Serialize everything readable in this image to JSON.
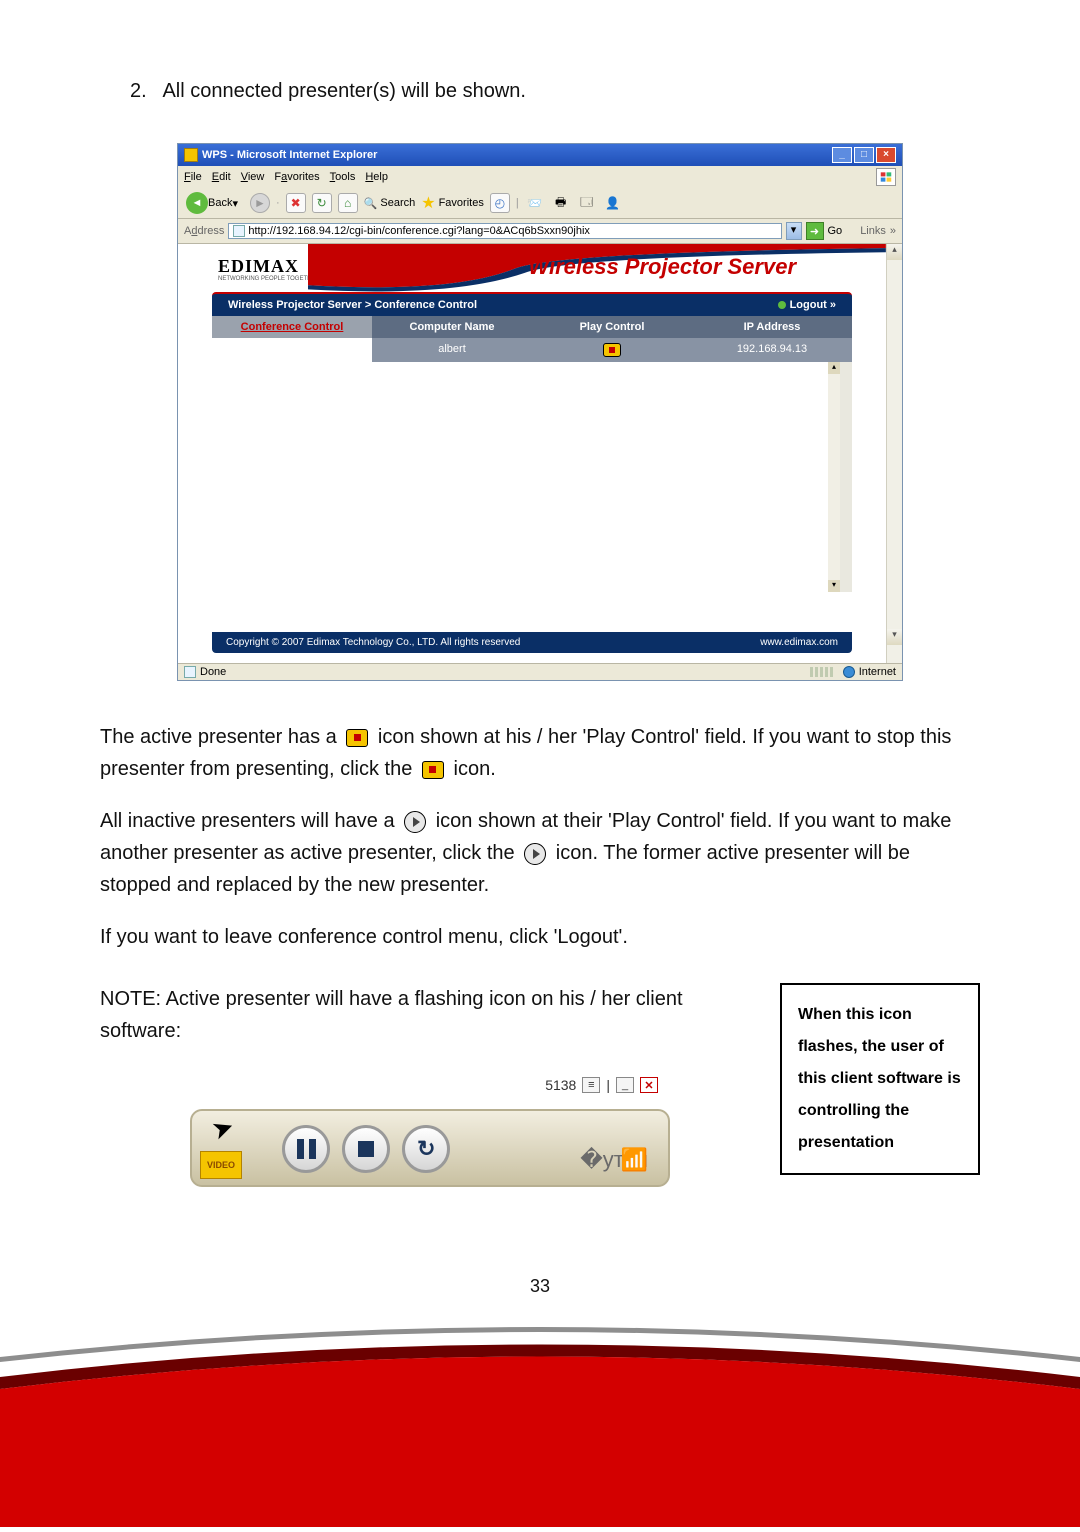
{
  "intro": {
    "num": "2.",
    "text": "All connected presenter(s) will be shown."
  },
  "ie": {
    "title": "WPS - Microsoft Internet Explorer",
    "menus": {
      "file": "File",
      "edit": "Edit",
      "view": "View",
      "favorites": "Favorites",
      "tools": "Tools",
      "help": "Help"
    },
    "toolbar": {
      "back": "Back",
      "search": "Search",
      "favorites": "Favorites"
    },
    "address_label": "Address",
    "url": "http://192.168.94.12/cgi-bin/conference.cgi?lang=0&ACq6bSxxn90jhix",
    "go": "Go",
    "links": "Links",
    "status_done": "Done",
    "status_zone": "Internet"
  },
  "wps": {
    "logo": "EDIMAX",
    "logo_sub": "NETWORKING PEOPLE TOGETHER",
    "title": "Wireless Projector Server",
    "breadcrumb": "Wireless Projector Server > Conference Control",
    "logout": "Logout »",
    "left_head": "Conference Control",
    "cols": {
      "name": "Computer Name",
      "play": "Play Control",
      "ip": "IP Address"
    },
    "row": {
      "name": "albert",
      "ip": "192.168.94.13"
    },
    "footer_copy": "Copyright © 2007 Edimax Technology Co., LTD. All rights reserved",
    "footer_site": "www.edimax.com"
  },
  "paras": {
    "p1a": "The active presenter has a",
    "p1b": "icon shown at his / her 'Play Control' field. If you want to stop this presenter from presenting, click the",
    "p1c": "icon.",
    "p2a": "All inactive presenters will have a",
    "p2b": "icon shown at their 'Play Control' field. If you want to make another presenter as active presenter, click the",
    "p2c": "icon. The former active presenter will be stopped and replaced by the new presenter.",
    "p3": "If you want to leave conference control menu, click 'Logout'.",
    "note": "NOTE: Active presenter will have a flashing icon on his / her client software:"
  },
  "note_box": "When this icon flashes, the user of this client software is controlling the presentation",
  "client": {
    "code": "5138",
    "video": "VIDEO"
  },
  "page_num": "33"
}
